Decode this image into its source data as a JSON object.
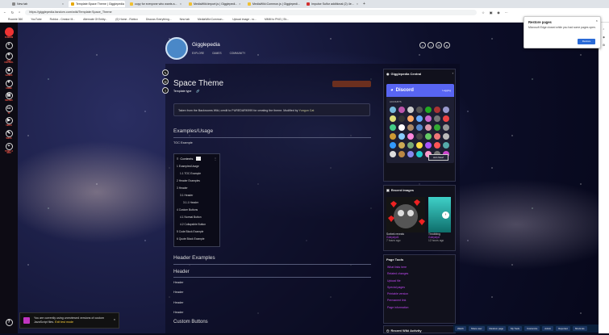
{
  "browser": {
    "tabs": [
      {
        "title": "New tab",
        "color": "#888888"
      },
      {
        "title": "Template:Space Theme | Gigglepedia",
        "color": "#e6a700",
        "active": true
      },
      {
        "title": "copy for everyone who wants a...",
        "color": "#f0c030"
      },
      {
        "title": "MediaWiki:import.js | Gigglepedi...",
        "color": "#f0c030"
      },
      {
        "title": "MediaWiki:Common.js | Gigglepedi...",
        "color": "#f0c030"
      },
      {
        "title": "Impulse Sulfur additional (2) 4e...",
        "color": "#d23030"
      }
    ],
    "url": "https://gigglepedia.fandom.com/wiki/Template:Space_Theme",
    "bookmarks": [
      "Roomie 360",
      "YouTube",
      "Roblox - Creator M...",
      "Alternate Of Entity...",
      "(0) Home - Roblox",
      "Discuss Everything...",
      "New tab",
      "MediaWiki:Common...",
      "Upload image - ro...",
      "MMM to PNG | Sh..."
    ]
  },
  "rail": [
    {
      "label": "FANDOM",
      "icon": "fandom-logo"
    },
    {
      "label": "",
      "icon": "search-icon"
    },
    {
      "label": "FAN CENTRAL",
      "icon": "compass-icon"
    },
    {
      "label": "GAMES",
      "icon": "gamepad-icon"
    },
    {
      "label": "ANIME",
      "icon": "heart-icon"
    },
    {
      "label": "MOVIES",
      "icon": "film-icon"
    },
    {
      "label": "TV",
      "icon": "tv-icon"
    },
    {
      "label": "VIDEO",
      "icon": "play-icon"
    },
    {
      "label": "WIKIS",
      "icon": "wiki-icon"
    },
    {
      "label": "START A WIKI",
      "icon": "plus-icon"
    }
  ],
  "wiki": {
    "name": "Gigglepedia",
    "nav": [
      "EXPLORE",
      "GAMES",
      "COMMUNITY"
    ]
  },
  "page": {
    "title": "Space Theme",
    "type": "Template type",
    "note_text": "Taken from the Backrooms Wiki, credit to PUREDARK999 for creating the theme. Modified by",
    "note_link": "Yungun Cat"
  },
  "content": {
    "h_examples": "Examples/Usage",
    "toc_example": "TOC Example",
    "toc_title": "Contents",
    "toc_items": [
      "1  Examples/Usage",
      "1.1  TOC Example",
      "2  Header Examples",
      "3  Header",
      "3.1  Header",
      "3.1.1  Header",
      "4  Custom Buttons",
      "4.1  Normal Button",
      "4.2  Collapsible Button",
      "5  Code Block Example",
      "6  Quote Block Example"
    ],
    "h_header_examples": "Header Examples",
    "h_header": "Header",
    "headers": [
      "Header",
      "Header",
      "Header",
      "Header"
    ],
    "h_custom_buttons": "Custom Buttons"
  },
  "sidebar": {
    "discord_title": "Gigglepedia Central",
    "discord_brand": "Discord",
    "discord_login": "Logging",
    "discord_online": "ACCOUNTS",
    "join_label": "Join Now!",
    "images_title": "Recent Images",
    "img1_caption": "Sorbek reveals",
    "img1_by": "Gobyclyd1",
    "img1_time": "7 hours ago",
    "img2_caption": "Throbbing",
    "img2_by": "Gobyclyd",
    "img2_time": "12 hours ago",
    "tools_title": "Page Tools",
    "tools": [
      "What links here",
      "Related changes",
      "Upload file",
      "Special pages",
      "Printable version",
      "Permanent link",
      "Page information"
    ],
    "activity_title": "Recent Wiki Activity"
  },
  "toast": {
    "text": "You are currently using unreviewed versions of custom JavaScript files.",
    "link": "Exit test mode"
  },
  "popup": {
    "title": "Restore pages",
    "body": "Microsoft Edge closed while you had some pages open.",
    "button": "Restore"
  },
  "toolbar": [
    "Watch",
    "Share user",
    "Random page",
    "My Tools",
    "Customize",
    "Admin",
    "Reported",
    "Shortcuts"
  ],
  "avatar_colors": [
    "#7bd",
    "#b5a",
    "#ccc",
    "#555",
    "#2a2",
    "#a33",
    "#99c",
    "#dd7",
    "#333",
    "#fa6",
    "#6af",
    "#c6c",
    "#777",
    "#e44",
    "#4c8",
    "#fff",
    "#a86",
    "#58c",
    "#d9a",
    "#3a3",
    "#999",
    "#c93",
    "#8cf",
    "#f8d",
    "#444",
    "#6c6",
    "#e77",
    "#bbb",
    "#39f",
    "#ca5",
    "#7a7",
    "#fd4",
    "#a5f",
    "#f55",
    "#5aa",
    "#ddd",
    "#b84",
    "#88e",
    "#2cc",
    "#f9c",
    "#777",
    "#c4c"
  ]
}
